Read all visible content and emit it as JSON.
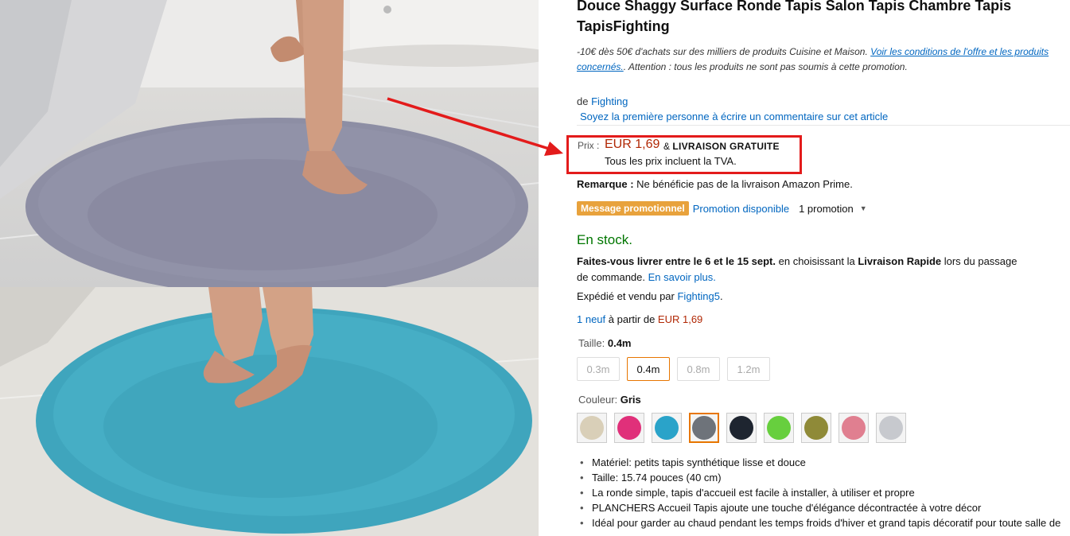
{
  "product": {
    "title": "Douce Shaggy Surface Ronde Tapis Salon Tapis Chambre Tapis TapisFighting",
    "promo_note_text": "-10€ dès 50€ d'achats sur des milliers de produits Cuisine et Maison. ",
    "promo_note_link": "Voir les conditions de l'offre et les produits concernés.",
    "promo_note_tail": ". Attention : tous les produits ne sont pas soumis à cette promotion.",
    "brand_prefix": "de ",
    "brand": "Fighting",
    "review_link": "Soyez la première personne à écrire un commentaire sur cet article"
  },
  "price": {
    "label": "Prix :",
    "value": "EUR 1,69",
    "amp": " & ",
    "shipping": "LIVRAISON GRATUITE",
    "tva": "Tous les prix incluent la TVA."
  },
  "remark": {
    "label": "Remarque :",
    "text": " Ne bénéficie pas de la livraison Amazon Prime."
  },
  "promotion": {
    "badge": "Message promotionnel",
    "link": "Promotion disponible",
    "count": "1 promotion",
    "caret": "▼"
  },
  "availability": {
    "stock": "En stock.",
    "delivery_bold1": "Faites-vous livrer entre le 6 et le 15 sept.",
    "delivery_text1": " en choisissant la ",
    "delivery_bold2": "Livraison Rapide",
    "delivery_text2": " lors du passage de commande. ",
    "delivery_link": "En savoir plus.",
    "shipped_prefix": "Expédié et vendu par ",
    "seller": "Fighting5",
    "seller_suffix": ".",
    "offers_link": "1 neuf",
    "offers_text": " à partir de ",
    "offers_price": "EUR 1,69"
  },
  "size": {
    "label": "Taille: ",
    "selected": "0.4m",
    "options": [
      "0.3m",
      "0.4m",
      "0.8m",
      "1.2m"
    ]
  },
  "color": {
    "label": "Couleur: ",
    "selected": "Gris",
    "swatches": [
      "#d9cfb8",
      "#e0307a",
      "#2aa3c9",
      "#6e737a",
      "#1e2530",
      "#67cf3e",
      "#8f8a38",
      "#e07f90",
      "#c7c9ce"
    ]
  },
  "bullets": [
    "Matériel: petits tapis synthétique lisse et douce",
    "Taille: 15.74 pouces (40 cm)",
    "La ronde simple, tapis d'accueil est facile à installer, à utiliser et propre",
    "PLANCHERS Accueil Tapis ajoute une touche d'élégance décontractée à votre décor",
    "Idéal pour garder au chaud pendant les temps froids d'hiver et grand tapis décoratif pour toute salle de"
  ],
  "colors": {
    "link": "#0066c0",
    "price": "#b12704",
    "stock": "#007600",
    "highlight_box": "#e31b1b",
    "promo_badge": "#e8a23c",
    "selected_border": "#e77600",
    "rug_top": "#8c8da3",
    "rug_bottom": "#3fa6bf"
  }
}
